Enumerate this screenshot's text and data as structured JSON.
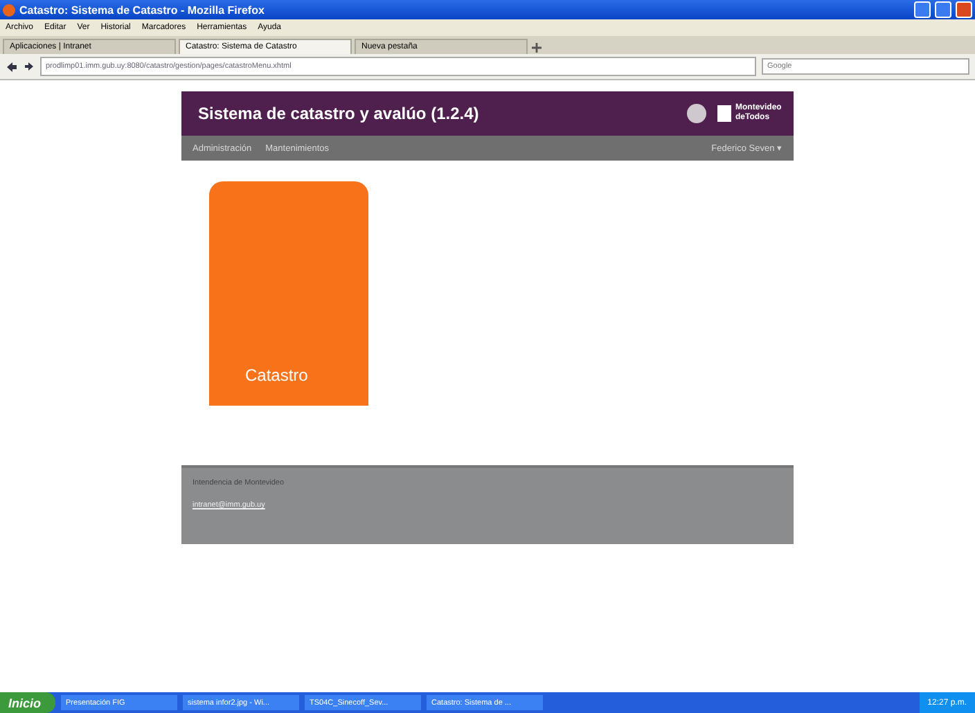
{
  "window": {
    "title": "Catastro: Sistema de Catastro - Mozilla Firefox"
  },
  "menu_bar": [
    "Archivo",
    "Editar",
    "Ver",
    "Historial",
    "Marcadores",
    "Herramientas",
    "Ayuda"
  ],
  "tabs": [
    {
      "label": "Aplicaciones | Intranet",
      "selected": false
    },
    {
      "label": "Catastro: Sistema de Catastro",
      "selected": true
    },
    {
      "label": "Nueva pestaña",
      "selected": false
    }
  ],
  "address_bar": {
    "url": "prodlimp01.imm.gub.uy:8080/catastro/gestion/pages/catastroMenu.xhtml"
  },
  "search": {
    "placeholder": "Google"
  },
  "header": {
    "title": "Sistema de catastro y avalúo (1.2.4)",
    "logo_text": "Montevideo deTodos"
  },
  "nav": {
    "items": [
      "Administración",
      "Mantenimientos"
    ],
    "user": "Federico Seven ▾"
  },
  "tiles": [
    {
      "label": "Catastro"
    }
  ],
  "footer": {
    "org": "Intendencia de Montevideo",
    "email": "intranet@imm.gub.uy"
  },
  "taskbar": {
    "start": "Inicio",
    "items": [
      "Presentación FIG",
      "sistema infor2.jpg - Wi...",
      "TS04C_Sinecoff_Sev...",
      "Catastro: Sistema de ..."
    ],
    "clock": "12:27 p.m."
  }
}
